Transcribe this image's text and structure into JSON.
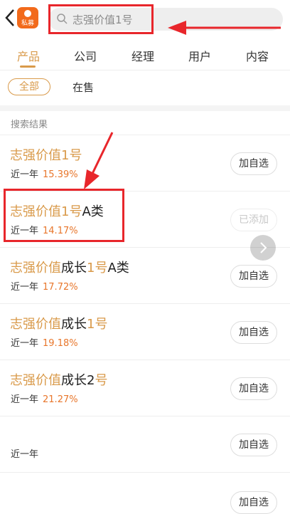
{
  "header": {
    "app_logo_text": "私募",
    "search_text": "志强价值1号"
  },
  "tabs": [
    {
      "label": "产品",
      "active": true
    },
    {
      "label": "公司",
      "active": false
    },
    {
      "label": "经理",
      "active": false
    },
    {
      "label": "用户",
      "active": false
    },
    {
      "label": "内容",
      "active": false
    }
  ],
  "filters": {
    "all": "全部",
    "on_sale": "在售"
  },
  "section_title": "搜索结果",
  "results": [
    {
      "name_hl": "志强价值1号",
      "name_rest": "",
      "period": "近一年",
      "return": "15.39%",
      "button": "加自选"
    },
    {
      "name_hl": "志强价值1号",
      "name_rest": "A类",
      "period": "近一年",
      "return": "14.17%",
      "button": "已添加"
    },
    {
      "name_hl": "志强价值",
      "name_rest": "成长",
      "name_hl2": "1号",
      "name_rest2": "A类",
      "period": "近一年",
      "return": "17.72%",
      "button": "加自选"
    },
    {
      "name_hl": "志强价值",
      "name_rest": "成长",
      "name_hl2": "1号",
      "name_rest2": "",
      "period": "近一年",
      "return": "19.18%",
      "button": "加自选"
    },
    {
      "name_hl": "志强价值",
      "name_rest": "成长2",
      "name_hl2": "号",
      "name_rest2": "",
      "period": "近一年",
      "return": "21.27%",
      "button": "加自选"
    },
    {
      "name_hl": "",
      "name_rest": "",
      "period": "近一年",
      "return": "",
      "button": "加自选"
    },
    {
      "name_hl": "",
      "name_rest": "",
      "period": "",
      "return": "",
      "button": "加自选"
    }
  ],
  "colors": {
    "accent": "#d99a4a",
    "annotation_red": "#e8262b",
    "return_orange": "#e8762b"
  }
}
